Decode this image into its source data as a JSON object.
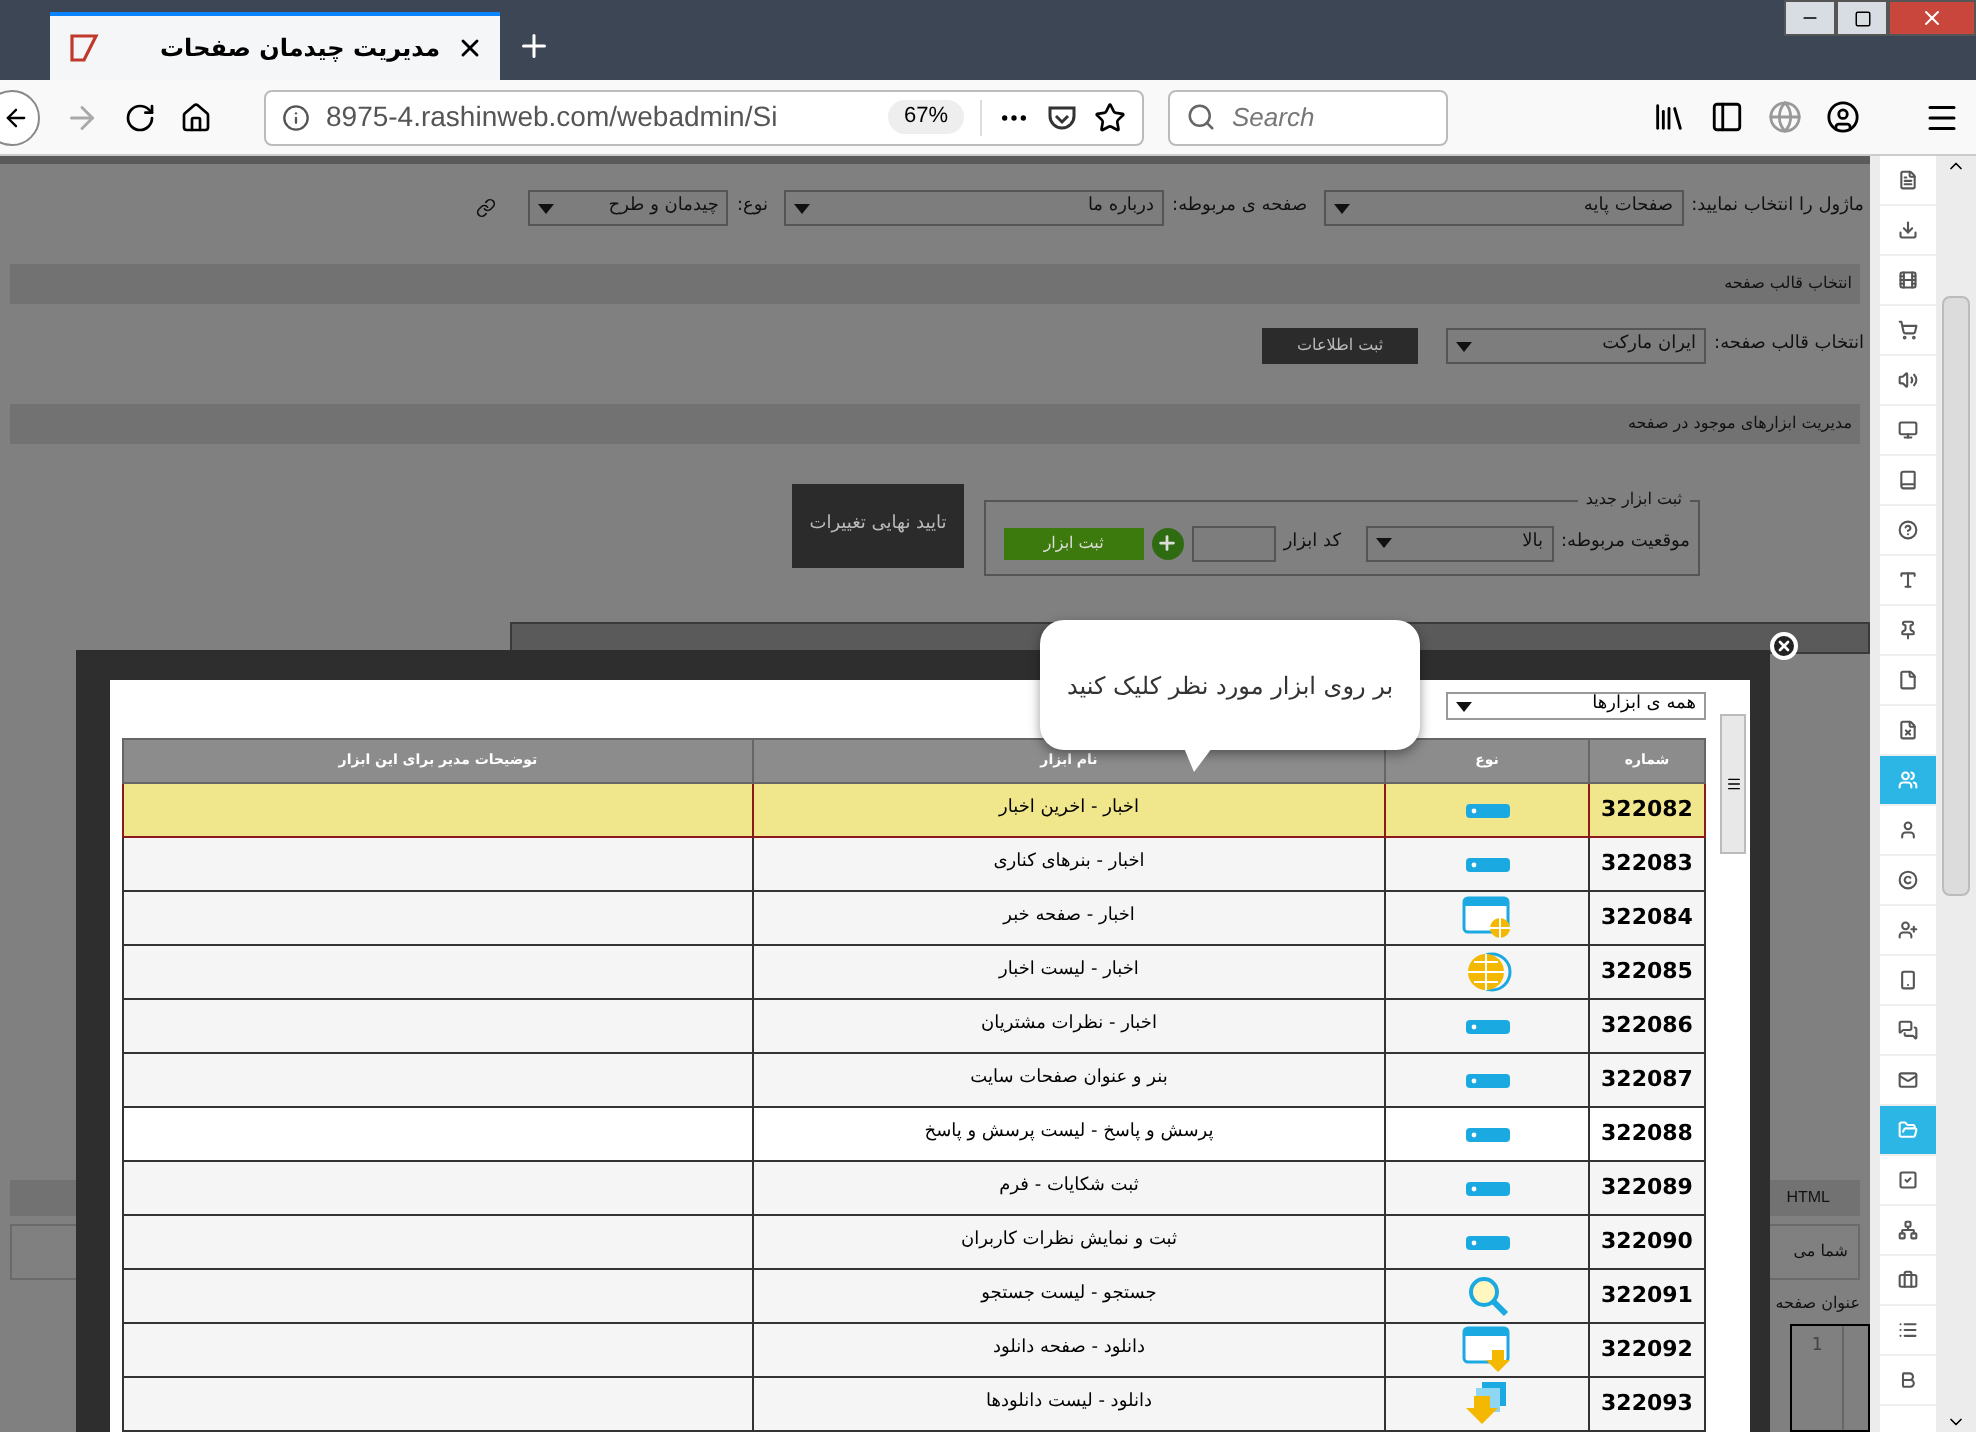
{
  "browser": {
    "tab_title": "مدیریت چیدمان صفحات",
    "url": "8975-4.rashinweb.com/webadmin/Si",
    "zoom": "67%",
    "search_placeholder": "Search"
  },
  "page": {
    "module_row": {
      "module_label": "ماژول را انتخاب نمایید:",
      "module_value": "صفحات پایه",
      "page_label": "صفحه ی مربوطه:",
      "page_value": "درباره ما",
      "type_label": "نوع:",
      "type_value": "چیدمان و طرح"
    },
    "template_section": {
      "title": "انتخاب قالب صفحه",
      "label": "انتخاب قالب صفحه:",
      "value": "ایران مارکت",
      "button": "ثبت اطلاعات"
    },
    "tools_section": {
      "title": "مدیریت ابزارهای موجود در صفحه",
      "legend": "ثبت ابزار جدید",
      "position_label": "موقعیت مربوطه:",
      "position_value": "بالا",
      "code_label": "کد ابزار",
      "add_button": "ثبت ابزار",
      "confirm_button": "تایید نهایی تغییرات"
    },
    "lower": {
      "html_label": "HTML",
      "partial_text": "شما می",
      "page_title_label": "عنوان صفحه",
      "line_number": "1"
    }
  },
  "modal": {
    "tooltip": "بر روی ابزار مورد نظر کلیک کنید",
    "filter": "همه ی ابزارها",
    "columns": [
      "شماره",
      "نوع",
      "نام ابزار",
      "توضیحات مدیر برای این ابزار"
    ],
    "rows": [
      {
        "number": "322082",
        "kind": "bar",
        "name": "اخبار - اخرین اخبار",
        "selected": true
      },
      {
        "number": "322083",
        "kind": "bar",
        "name": "اخبار - بنرهای کناری",
        "selected": false
      },
      {
        "number": "322084",
        "kind": "window-globe",
        "name": "اخبار - صفحه خبر",
        "selected": false
      },
      {
        "number": "322085",
        "kind": "globe",
        "name": "اخبار - لیست اخبار",
        "selected": false
      },
      {
        "number": "322086",
        "kind": "bar",
        "name": "اخبار - نظرات مشتریان",
        "selected": false
      },
      {
        "number": "322087",
        "kind": "bar",
        "name": "بنر و عنوان صفحات سایت",
        "selected": false
      },
      {
        "number": "322088",
        "kind": "bar",
        "name": "پرسش و پاسخ - لیست پرسش و پاسخ",
        "selected": false
      },
      {
        "number": "322089",
        "kind": "bar",
        "name": "ثبت شکایات - فرم",
        "selected": false
      },
      {
        "number": "322090",
        "kind": "bar",
        "name": "ثبت و نمایش نظرات کاربران",
        "selected": false
      },
      {
        "number": "322091",
        "kind": "search",
        "name": "جستجو - لیست جستجو",
        "selected": false
      },
      {
        "number": "322092",
        "kind": "window-download",
        "name": "دانلود - صفحه دانلود",
        "selected": false
      },
      {
        "number": "322093",
        "kind": "download",
        "name": "دانلود - لیست دانلودها",
        "selected": false
      }
    ]
  },
  "sidebar": {
    "items": [
      {
        "selected": false
      },
      {
        "selected": false
      },
      {
        "selected": false
      },
      {
        "selected": false
      },
      {
        "selected": false
      },
      {
        "selected": false
      },
      {
        "selected": false
      },
      {
        "selected": false
      },
      {
        "selected": false
      },
      {
        "selected": false
      },
      {
        "selected": false
      },
      {
        "selected": false
      },
      {
        "selected": true
      },
      {
        "selected": false
      },
      {
        "selected": false
      },
      {
        "selected": false
      },
      {
        "selected": false
      },
      {
        "selected": false
      },
      {
        "selected": false
      },
      {
        "selected": true
      },
      {
        "selected": false
      },
      {
        "selected": false
      },
      {
        "selected": false
      },
      {
        "selected": false
      },
      {
        "selected": false
      }
    ]
  }
}
